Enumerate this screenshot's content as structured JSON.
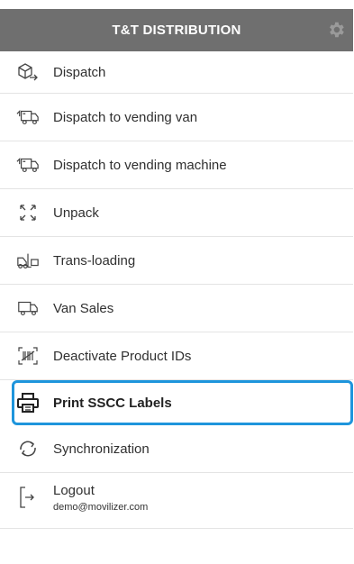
{
  "header": {
    "title": "T&T DISTRIBUTION",
    "settings_icon": "gear-icon"
  },
  "menu": {
    "items": [
      {
        "label": "Dispatch",
        "icon": "box-arrow-icon"
      },
      {
        "label": "Dispatch to vending van",
        "icon": "truck-icon"
      },
      {
        "label": "Dispatch to vending machine",
        "icon": "truck-icon"
      },
      {
        "label": "Unpack",
        "icon": "expand-arrows-icon"
      },
      {
        "label": "Trans-loading",
        "icon": "forklift-icon"
      },
      {
        "label": "Van Sales",
        "icon": "van-icon"
      },
      {
        "label": "Deactivate Product IDs",
        "icon": "barcode-scan-icon"
      },
      {
        "label": "Print SSCC Labels",
        "icon": "printer-icon"
      },
      {
        "label": "Synchronization",
        "icon": "sync-icon"
      }
    ],
    "logout": {
      "label": "Logout",
      "user": "demo@movilizer.com",
      "icon": "logout-icon"
    }
  },
  "colors": {
    "header_bg": "#6f6f6f",
    "selected_border": "#1e95dc"
  }
}
